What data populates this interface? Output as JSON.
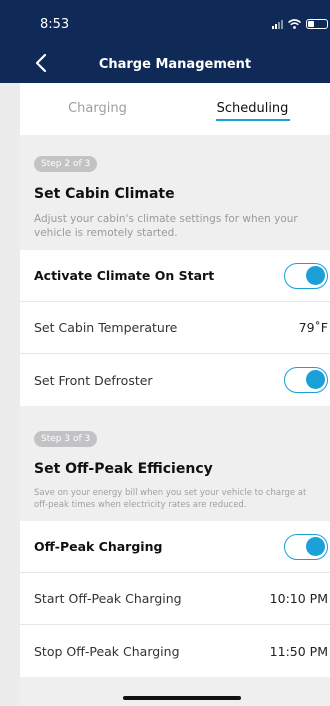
{
  "status": {
    "time": "8:53"
  },
  "header": {
    "title": "Charge Management"
  },
  "tabs": [
    {
      "label": "Charging",
      "active": false
    },
    {
      "label": "Scheduling",
      "active": true
    }
  ],
  "colors": {
    "navy": "#0f2a57",
    "accent": "#1ba0d8"
  },
  "cabin": {
    "step": "Step 2 of 3",
    "title": "Set Cabin Climate",
    "desc": "Adjust your cabin's climate settings for when your vehicle is remotely started.",
    "rows": [
      {
        "label": "Activate Climate On Start",
        "type": "toggle",
        "on": true
      },
      {
        "label": "Set Cabin Temperature",
        "type": "value",
        "value": "79˚F"
      },
      {
        "label": "Set Front Defroster",
        "type": "toggle",
        "on": true
      }
    ]
  },
  "offpeak": {
    "step": "Step 3 of 3",
    "title": "Set Off-Peak Efficiency",
    "desc": "Save on your energy bill when you set your vehicle to charge at off-peak times when electricity rates are reduced.",
    "rows": [
      {
        "label": "Off-Peak Charging",
        "type": "toggle",
        "on": true
      },
      {
        "label": "Start Off-Peak Charging",
        "type": "value",
        "value": "10:10 PM"
      },
      {
        "label": "Stop Off-Peak Charging",
        "type": "value",
        "value": "11:50 PM"
      }
    ]
  }
}
